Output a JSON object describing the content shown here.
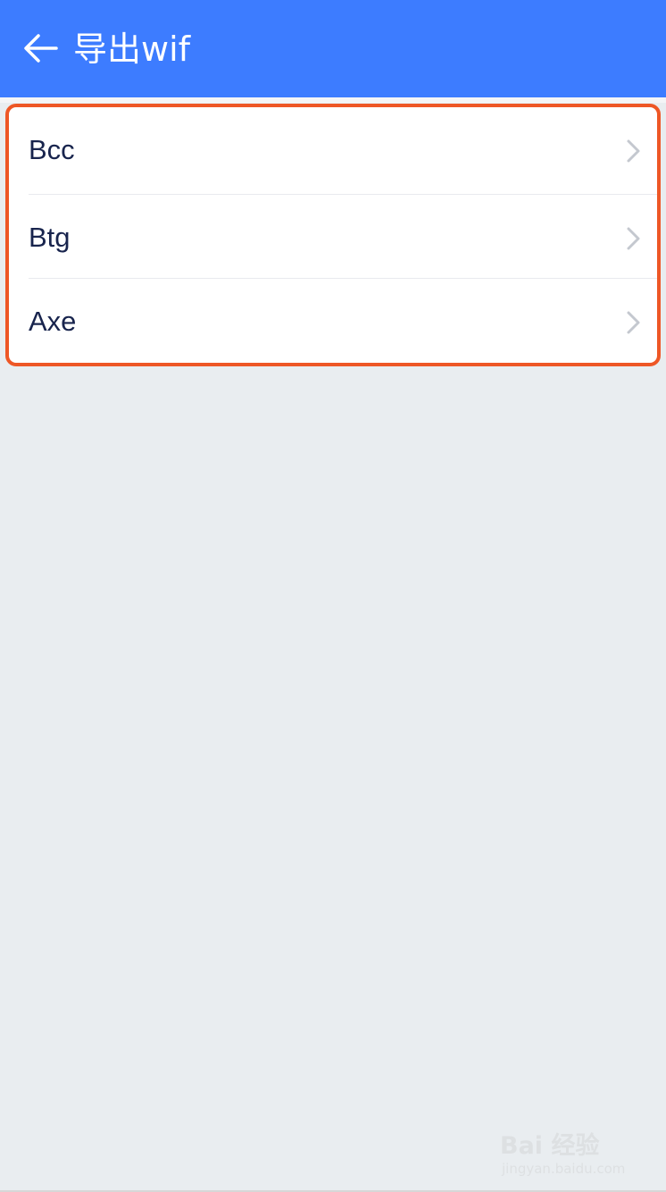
{
  "header": {
    "title": "导出wif",
    "back_icon": "arrow-left-icon",
    "background_color": "#3d7cff"
  },
  "list": {
    "items": [
      {
        "label": "Bcc",
        "icon": "chevron-right-icon"
      },
      {
        "label": "Btg",
        "icon": "chevron-right-icon"
      },
      {
        "label": "Axe",
        "icon": "chevron-right-icon"
      }
    ],
    "highlight_border_color": "#ee5726"
  },
  "watermark": {
    "brand": "Bai 经验",
    "url": "jingyan.baidu.com"
  },
  "colors": {
    "background": "#e9edf0",
    "text": "#18244d",
    "chevron": "#c4c8cf"
  }
}
